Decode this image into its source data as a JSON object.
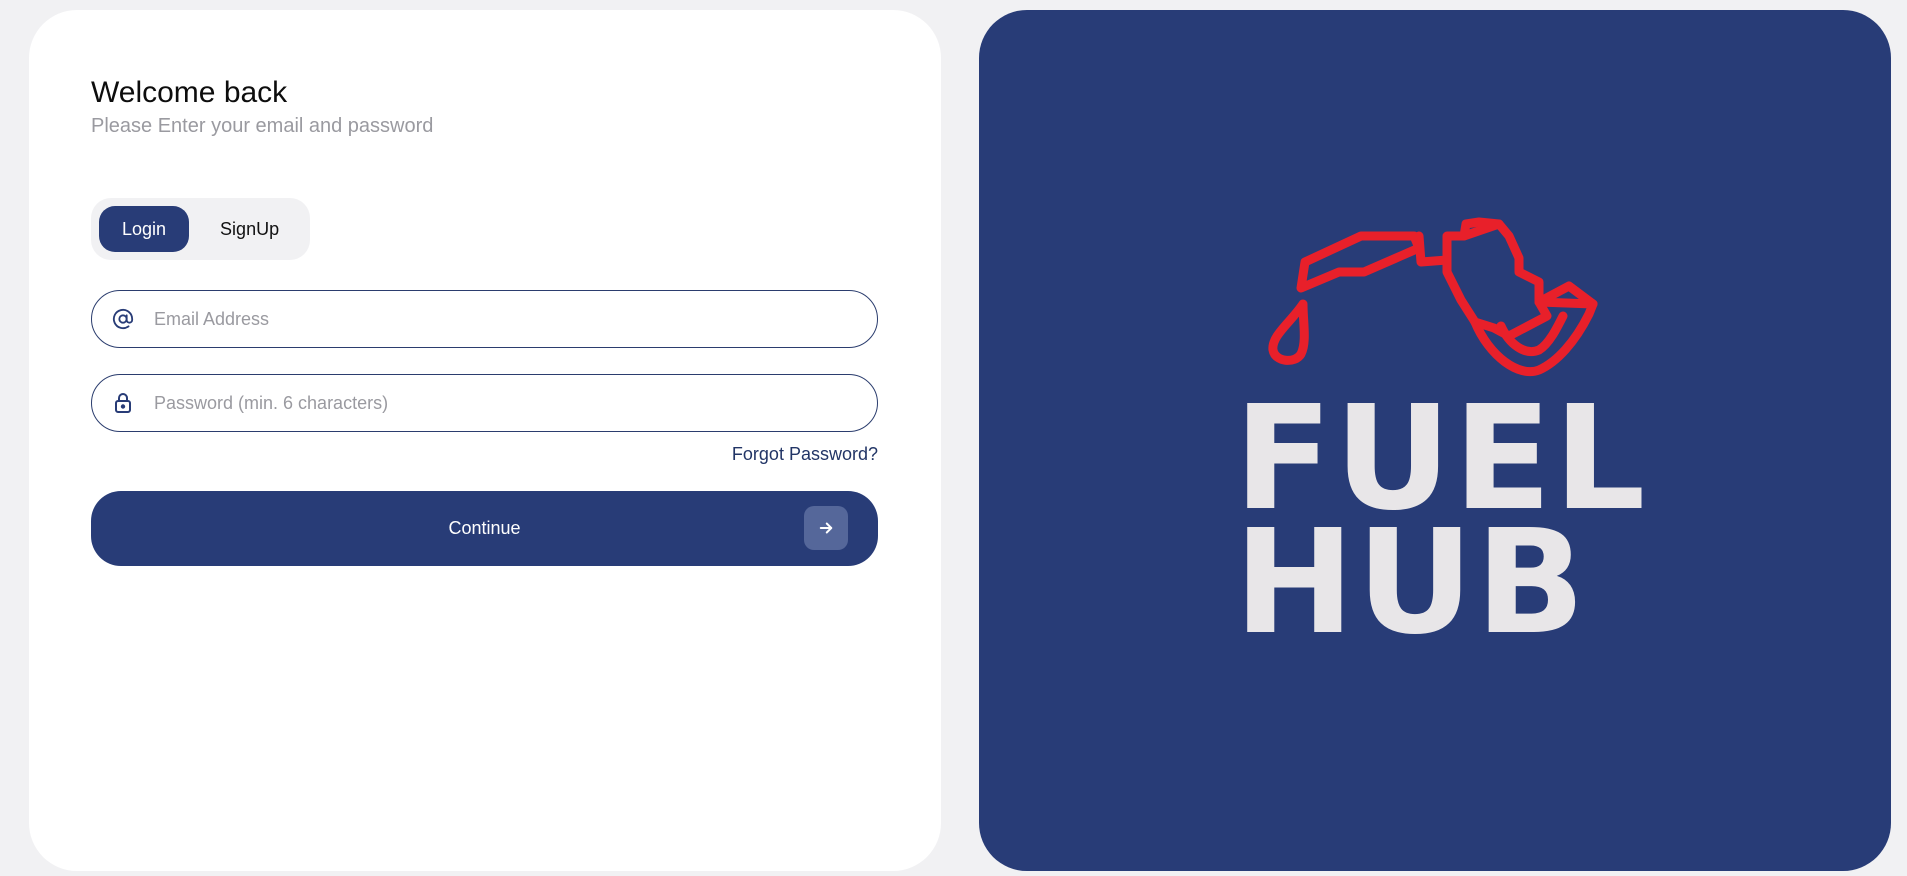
{
  "form": {
    "title": "Welcome back",
    "subtitle": "Please Enter your email and password",
    "tabs": [
      {
        "label": "Login",
        "active": true
      },
      {
        "label": "SignUp",
        "active": false
      }
    ],
    "email_placeholder": "Email Address",
    "password_placeholder": "Password (min. 6 characters)",
    "forgot_label": "Forgot Password?",
    "continue_label": "Continue"
  },
  "brand": {
    "line1": "FUEL",
    "line2": "HUB",
    "primary_color": "#283c77",
    "accent_color": "#e8202a",
    "text_color": "#e8e6e8",
    "icons": [
      "fuel-nozzle-icon",
      "fuel-drop-icon"
    ]
  }
}
